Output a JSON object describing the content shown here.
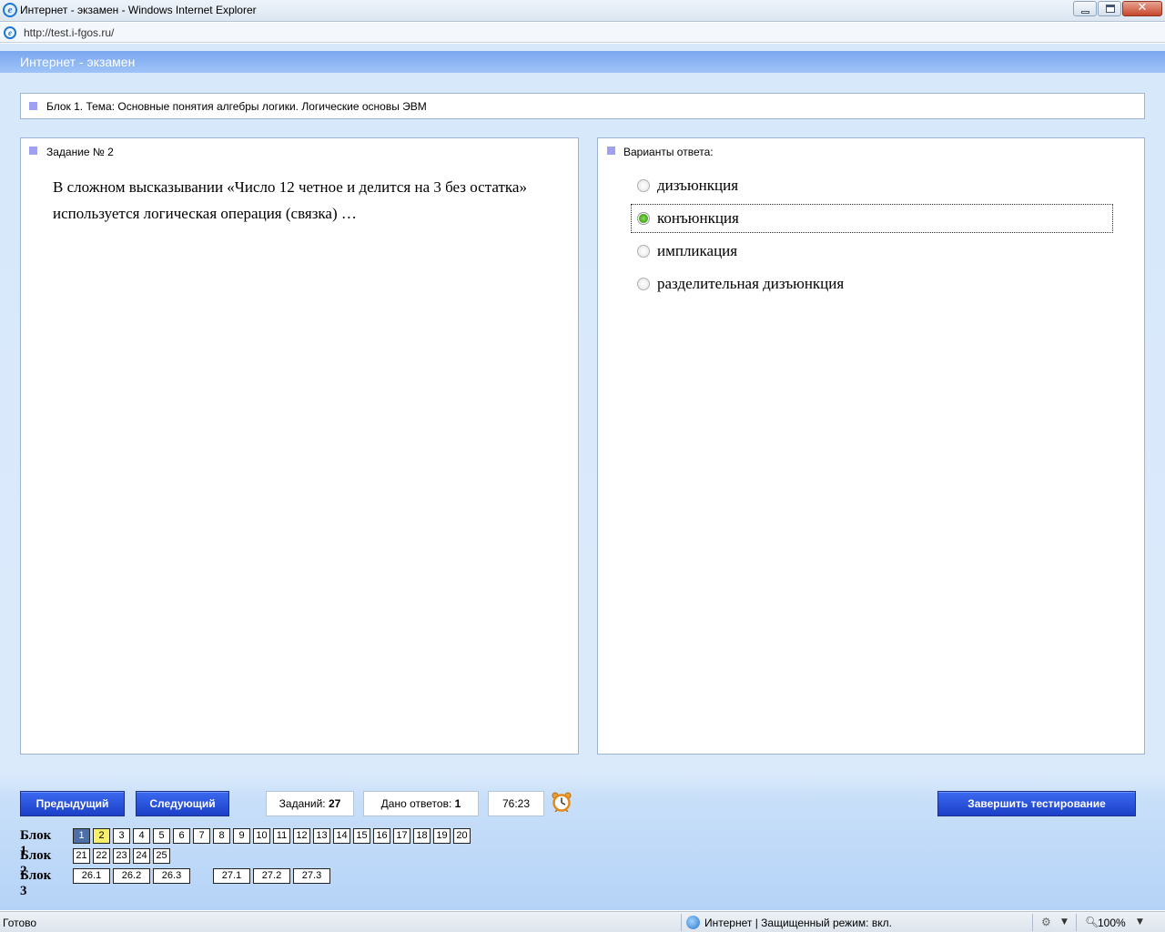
{
  "window": {
    "title": "Интернет - экзамен - Windows Internet Explorer",
    "url": "http://test.i-fgos.ru/"
  },
  "app": {
    "header_title": "Интернет - экзамен",
    "block_topic": "Блок 1. Тема: Основные понятия алгебры логики. Логические основы ЭВМ"
  },
  "task": {
    "title": "Задание № 2",
    "text": "В сложном высказывании «Число 12 четное и делится на 3 без остатка» используется логическая операция (связка) …"
  },
  "answers": {
    "title": "Варианты ответа:",
    "options": [
      {
        "label": "дизъюнкция",
        "selected": false
      },
      {
        "label": "конъюнкция",
        "selected": true
      },
      {
        "label": "импликация",
        "selected": false
      },
      {
        "label": "разделительная дизъюнкция",
        "selected": false
      }
    ]
  },
  "controls": {
    "prev_label": "Предыдущий",
    "next_label": "Следующий",
    "finish_label": "Завершить тестирование",
    "tasks_label": "Заданий:",
    "tasks_count": "27",
    "answers_label": "Дано ответов:",
    "answers_count": "1",
    "timer": "76:23"
  },
  "navigator": {
    "block1_label": "Блок 1",
    "block2_label": "Блок 2",
    "block3_label": "Блок 3",
    "block1": [
      "1",
      "2",
      "3",
      "4",
      "5",
      "6",
      "7",
      "8",
      "9",
      "10",
      "11",
      "12",
      "13",
      "14",
      "15",
      "16",
      "17",
      "18",
      "19",
      "20"
    ],
    "block2": [
      "21",
      "22",
      "23",
      "24",
      "25"
    ],
    "block3": [
      "26.1",
      "26.2",
      "26.3",
      "27.1",
      "27.2",
      "27.3"
    ],
    "current": "1",
    "answered": [
      "2"
    ]
  },
  "statusbar": {
    "status": "Готово",
    "zone": "Интернет | Защищенный режим: вкл.",
    "zoom": "100%"
  },
  "icons": {
    "browser": "ie-logo-icon",
    "timer": "alarm-clock-icon",
    "zone": "globe-icon"
  },
  "colors": {
    "accent_button": "#1c3fc8",
    "current_cell": "#4b6fa6",
    "answered_cell": "#f7f06a",
    "selected_radio": "#3fa71a",
    "bullet": "#a0a0f0"
  }
}
